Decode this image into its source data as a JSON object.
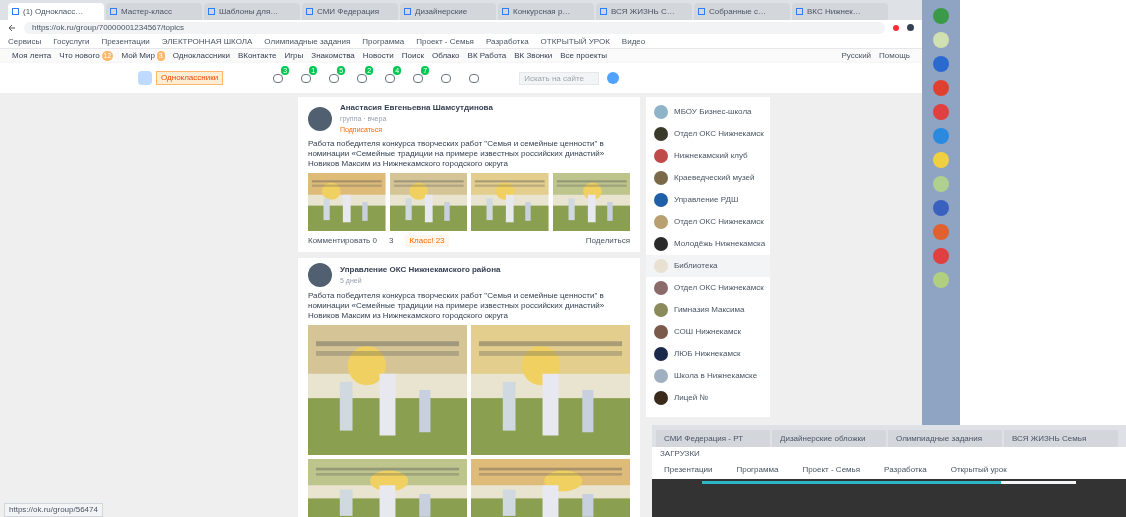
{
  "browser": {
    "tabs": [
      {
        "label": "(1) Однокласс…",
        "selected": true
      },
      {
        "label": "Мастер-класс",
        "selected": false
      },
      {
        "label": "Шаблоны для…",
        "selected": false
      },
      {
        "label": "СМИ Федерация",
        "selected": false
      },
      {
        "label": "Дизайнерские",
        "selected": false
      },
      {
        "label": "Конкурсная р…",
        "selected": false
      },
      {
        "label": "ВСЯ ЖИЗНЬ С…",
        "selected": false
      },
      {
        "label": "Собранные с…",
        "selected": false
      },
      {
        "label": "ВКС Нижнек…",
        "selected": false
      }
    ],
    "address": "https://ok.ru/group/70000001234567/topics",
    "bookmarks": [
      "Сервисы",
      "Госуслуги",
      "Презентации",
      "ЭЛЕКТРОННАЯ ШКОЛА",
      "Олимпиадные задания",
      "Программа",
      "Проект - Семья",
      "Разработка",
      "ОТКРЫТЫЙ УРОК",
      "Видео"
    ]
  },
  "portal_links": [
    {
      "label": "Моя лента"
    },
    {
      "label": "Что нового",
      "badge": "12"
    },
    {
      "label": "Мой Мир",
      "badge": "3"
    },
    {
      "label": "Одноклассники"
    },
    {
      "label": "ВКонтакте"
    },
    {
      "label": "Игры"
    },
    {
      "label": "Знакомства"
    },
    {
      "label": "Новости"
    },
    {
      "label": "Поиск"
    },
    {
      "label": "Облако"
    },
    {
      "label": "ВК Работа"
    },
    {
      "label": "ВК Звонки"
    },
    {
      "label": "Все проекты"
    }
  ],
  "portal_right": [
    "Русский",
    "Помощь"
  ],
  "toolbar": {
    "site_label": "Одноклассники",
    "nav_badges": [
      "3",
      "1",
      "5",
      "2",
      "4",
      "7"
    ],
    "search": {
      "placeholder": "Искать на сайте"
    }
  },
  "posts": [
    {
      "author": "Анастасия Евгеньевна Шамсутдинова",
      "meta": "группа · вчера",
      "tag": "Подписаться",
      "text": "Работа победителя конкурса творческих работ \"Семья и семейные ценности\" в номинации «Семейные традиции на примере известных российских династий» Новиков Максим из Нижнекамского городского округа",
      "kind": "strip",
      "actions": {
        "comments": "Комментировать 0",
        "shares": "3",
        "likes": "Класс! 23",
        "share": "Поделиться"
      }
    },
    {
      "author": "Управление ОКС Нижнекамского района",
      "meta": "5 дней",
      "text": "Работа победителя конкурса творческих работ \"Семья и семейные ценности\" в номинации «Семейные традиции на примере известных российских династий» Новиков Максим из Нижнекамского городского округа",
      "kind": "collage"
    }
  ],
  "groups": [
    {
      "name": "МБОУ Бизнес-школа",
      "color": "#8fb3c9",
      "selected": false
    },
    {
      "name": "Отдел ОКС Нижнекамск",
      "color": "#3a3a2a",
      "selected": false
    },
    {
      "name": "Нижнекамский клуб",
      "color": "#c04a4a",
      "selected": false
    },
    {
      "name": "Краеведческий музей",
      "color": "#7a6a4a",
      "selected": false
    },
    {
      "name": "Управление РДШ",
      "color": "#1f5fa8",
      "selected": false
    },
    {
      "name": "Отдел ОКС Нижнекамск",
      "color": "#b8a070",
      "selected": false
    },
    {
      "name": "Молодёжь Нижнекамска",
      "color": "#2a2a2a",
      "selected": false
    },
    {
      "name": "Библиотека",
      "color": "#e8e0d0",
      "selected": true
    },
    {
      "name": "Отдел ОКС Нижнекамск",
      "color": "#8a6a6a",
      "selected": false
    },
    {
      "name": "Гимназия Максима",
      "color": "#8a8a5a",
      "selected": false
    },
    {
      "name": "СОШ Нижнекамск",
      "color": "#7a5a4a",
      "selected": false
    },
    {
      "name": "ЛЮБ Нижнекамск",
      "color": "#1a2a4a",
      "selected": false
    },
    {
      "name": "Школа в Нижнекамске",
      "color": "#a0b0c0",
      "selected": false
    },
    {
      "name": "Лицей №",
      "color": "#3a2a1a",
      "selected": false
    }
  ],
  "status_url": "https://ok.ru/group/56474",
  "second_window": {
    "tabs": [
      "СМИ Федерация - РТ",
      "Дизайнерские обложки",
      "Олимпиадные задания",
      "ВСЯ ЖИЗНЬ Семья"
    ],
    "downloads": "ЗАГРУЗКИ",
    "bookmarks": [
      "Презентации",
      "Программа",
      "Проект - Семья",
      "Разработка",
      "Открытый урок"
    ],
    "level": 0.8
  }
}
